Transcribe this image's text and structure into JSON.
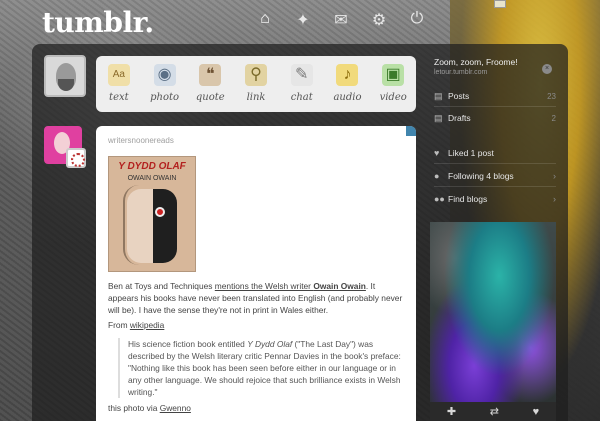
{
  "header": {
    "logo": "tumblr."
  },
  "post_types": [
    {
      "label": "text",
      "icon": "text-icon",
      "symbol": "Aa",
      "color": "#e2c27a"
    },
    {
      "label": "photo",
      "icon": "photo-icon",
      "symbol": "◉",
      "color": "#c9d3de"
    },
    {
      "label": "quote",
      "icon": "quote-icon",
      "symbol": "❝",
      "color": "#b69a7a"
    },
    {
      "label": "link",
      "icon": "link-icon",
      "symbol": "⚲",
      "color": "#c0a865"
    },
    {
      "label": "chat",
      "icon": "chat-icon",
      "symbol": "✎",
      "color": "#d5d5d5"
    },
    {
      "label": "audio",
      "icon": "audio-icon",
      "symbol": "♪",
      "color": "#e6c14a"
    },
    {
      "label": "video",
      "icon": "video-icon",
      "symbol": "▣",
      "color": "#7fbf6a"
    }
  ],
  "post": {
    "author": "writersnoonereads",
    "book": {
      "title": "Y DYDD OLAF",
      "author": "OWAIN OWAIN"
    },
    "p1_a": "Ben at Toys and Techniques ",
    "p1_link": "mentions the Welsh writer ",
    "p1_name": "Owain Owain",
    "p1_b": ". It appears his books have never been translated into English (and probably never will be). I have the sense they're not in print in Wales either.",
    "from_label": "From ",
    "from_link": "wikipedia",
    "quote_a": "His science fiction book entitled ",
    "quote_title": "Y Dydd Olaf",
    "quote_b": " (\"The Last Day\") was described by the Welsh literary critic Pennar Davies in the book's preface: \"Nothing like this book has been seen before either in our language or in any other language. We should rejoice that such brilliance exists in Welsh writing.\"",
    "via_label": "this photo via ",
    "via_link": "Gwenno"
  },
  "sidebar": {
    "blog_title": "Zoom, zoom, Froome!",
    "blog_url": "letour.tumblr.com",
    "rows": [
      {
        "label": "Posts",
        "count": "23",
        "icon": "posts-icon",
        "symbol": "▤"
      },
      {
        "label": "Drafts",
        "count": "2",
        "icon": "drafts-icon",
        "symbol": "▤"
      },
      {
        "label": "Liked 1 post",
        "count": "",
        "icon": "heart-icon",
        "symbol": "♥"
      },
      {
        "label": "Following 4 blogs",
        "count": "",
        "icon": "user-icon",
        "symbol": "👤"
      },
      {
        "label": "Find blogs",
        "count": "",
        "icon": "find-blogs-icon",
        "symbol": "👥"
      }
    ]
  }
}
